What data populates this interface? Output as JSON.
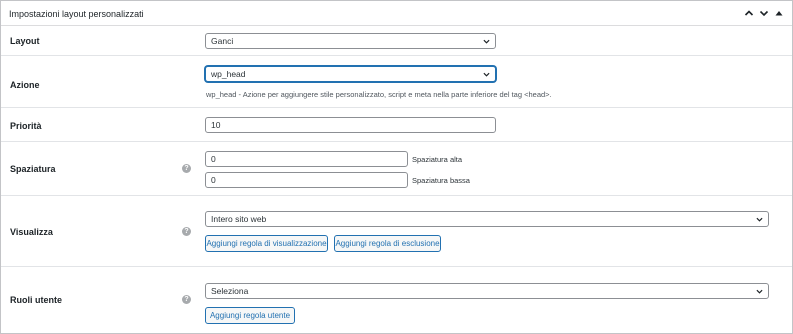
{
  "panel": {
    "title": "Impostazioni layout personalizzati",
    "controls": [
      "chevron-up-icon",
      "chevron-down-icon",
      "triangle-up-icon"
    ]
  },
  "layout": {
    "label": "Layout",
    "value": "Ganci"
  },
  "azione": {
    "label": "Azione",
    "value": "wp_head",
    "description": "wp_head - Azione per aggiungere stile personalizzato, script e meta nella parte inferiore del tag <head>."
  },
  "priorita": {
    "label": "Priorità",
    "value": "10"
  },
  "spaziatura": {
    "label": "Spaziatura",
    "help": "?",
    "top_value": "0",
    "top_label": "Spaziatura alta",
    "bottom_value": "0",
    "bottom_label": "Spaziatura bassa"
  },
  "visualizza": {
    "label": "Visualizza",
    "help": "?",
    "value": "Intero sito web",
    "add_display_rule": "Aggiungi regola di visualizzazione",
    "add_exclusion_rule": "Aggiungi regola di esclusione"
  },
  "ruoli": {
    "label": "Ruoli utente",
    "help": "?",
    "value": "Seleziona",
    "add_user_rule": "Aggiungi regola utente"
  },
  "colors": {
    "accent": "#2271b1",
    "border": "#8c8f94",
    "help_icon": "#a7aaad"
  }
}
